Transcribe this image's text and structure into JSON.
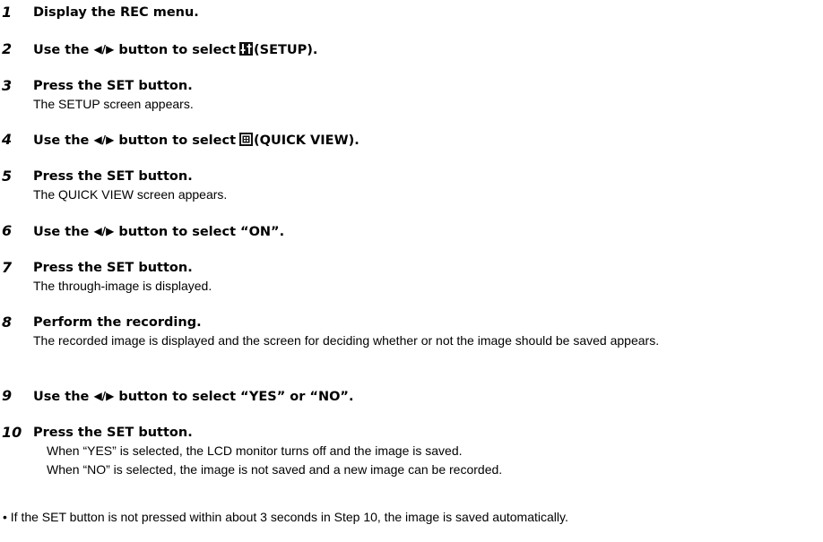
{
  "steps": [
    {
      "num": "1",
      "title": "Display the REC menu.",
      "desc": []
    },
    {
      "num": "2",
      "pre": "Use the",
      "arrows": "◀/▶",
      "mid": "button to select",
      "icon": "setup-icon",
      "post": "(SETUP).",
      "desc": []
    },
    {
      "num": "3",
      "title": "Press the SET button.",
      "desc": [
        "The SETUP screen appears."
      ]
    },
    {
      "num": "4",
      "pre": "Use the",
      "arrows": "◀/▶",
      "mid": "button to select",
      "icon": "quick-view-icon",
      "post": "(QUICK VIEW).",
      "desc": []
    },
    {
      "num": "5",
      "title": "Press the SET button.",
      "desc": [
        "The QUICK VIEW screen appears."
      ]
    },
    {
      "num": "6",
      "pre": "Use the",
      "arrows": "◀/▶",
      "mid": "button to select “ON”.",
      "desc": []
    },
    {
      "num": "7",
      "title": "Press the SET button.",
      "desc": [
        "The through-image is displayed."
      ]
    },
    {
      "num": "8",
      "title": "Perform the recording.",
      "desc": [
        "The recorded image is displayed and the screen for deciding whether or not the image should be saved appears."
      ]
    },
    {
      "num": "9",
      "pre": "Use the",
      "arrows": "◀/▶",
      "mid": "button to select “YES” or “NO”.",
      "desc": []
    },
    {
      "num": "10",
      "title": "Press the SET button.",
      "desc": [
        "When “YES” is selected, the LCD monitor turns off and the image is saved.",
        "When “NO” is selected, the image is not saved and a new image can be recorded."
      ]
    }
  ],
  "note": "• If the SET button is not pressed within about 3 seconds in Step 10, the image is saved automatically."
}
